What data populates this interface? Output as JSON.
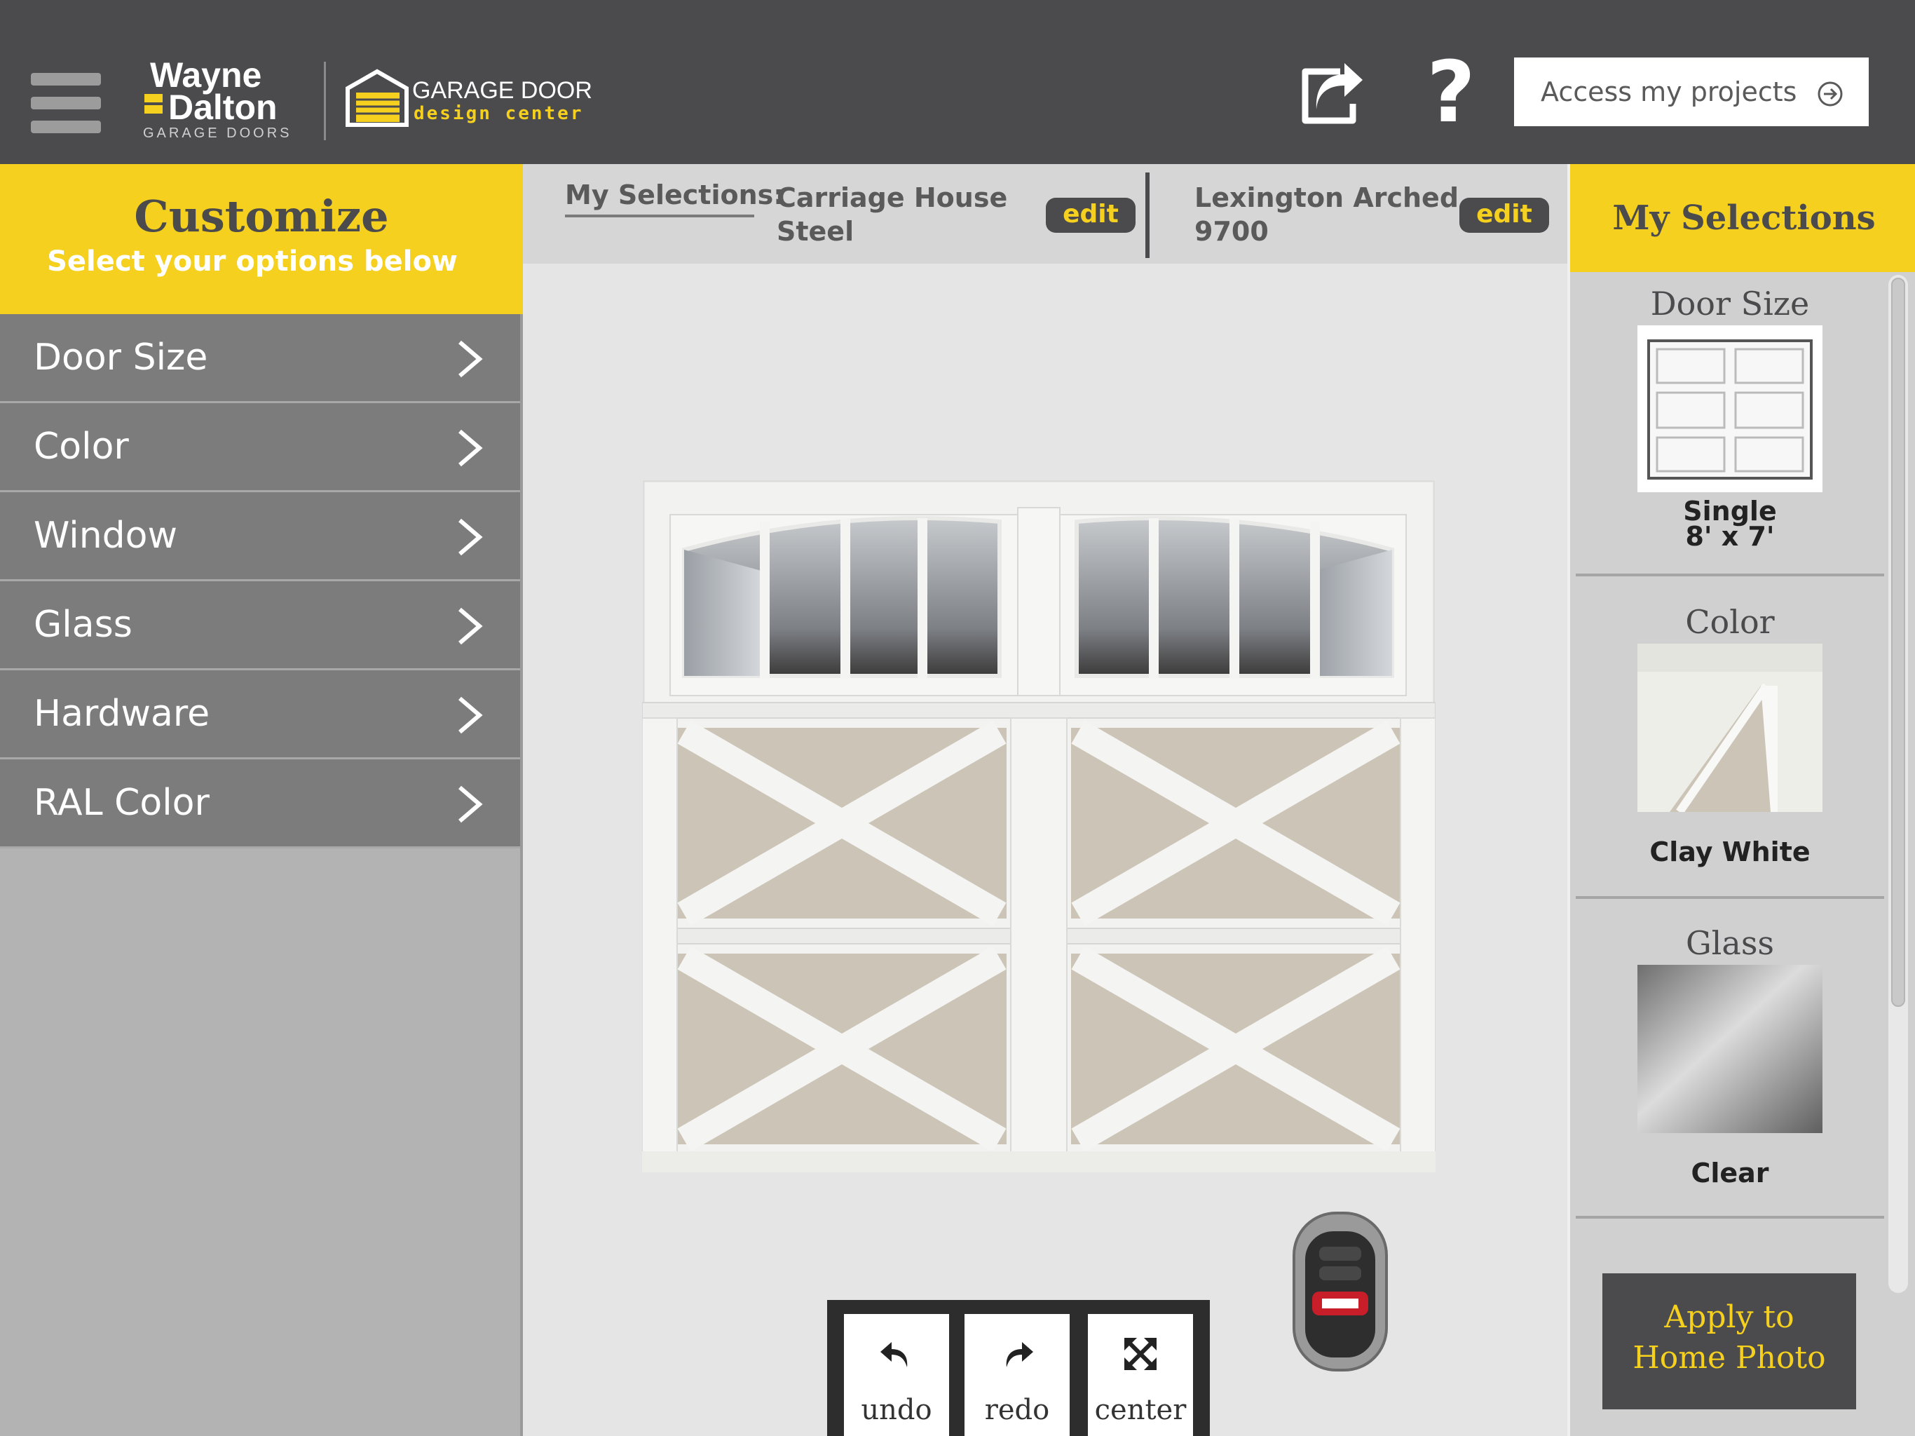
{
  "header": {
    "brand": {
      "line1": "Wayne",
      "line2": "Dalton",
      "line3": "GARAGE DOORS"
    },
    "design_center": {
      "line1": "GARAGE DOOR",
      "line2": "design center"
    },
    "help_label": "?",
    "access_projects_label": "Access my projects"
  },
  "left_panel": {
    "title": "Customize",
    "subtitle": "Select your options below",
    "menu": [
      {
        "label": "Door Size"
      },
      {
        "label": "Color"
      },
      {
        "label": "Window"
      },
      {
        "label": "Glass"
      },
      {
        "label": "Hardware"
      },
      {
        "label": "RAL Color"
      }
    ]
  },
  "selection_bar": {
    "label": "My Selections:",
    "items": [
      {
        "line1": "Carriage House",
        "line2": "Steel",
        "edit_label": "edit"
      },
      {
        "line1": "Lexington Arched",
        "line2": "9700",
        "edit_label": "edit"
      }
    ]
  },
  "toolbar": {
    "undo_label": "undo",
    "redo_label": "redo",
    "center_label": "center"
  },
  "right_panel": {
    "title": "My Selections",
    "cards": [
      {
        "title": "Door Size",
        "value_line1": "Single",
        "value_line2": "8' x 7'"
      },
      {
        "title": "Color",
        "value_line1": "Clay White"
      },
      {
        "title": "Glass",
        "value_line1": "Clear"
      }
    ],
    "apply_label_line1": "Apply to",
    "apply_label_line2": "Home Photo"
  },
  "colors": {
    "header_bg": "#4b4b4d",
    "accent_yellow": "#f5d01f",
    "menu_bg": "#7c7c7c",
    "panel_bg": "#d0d0d0"
  }
}
